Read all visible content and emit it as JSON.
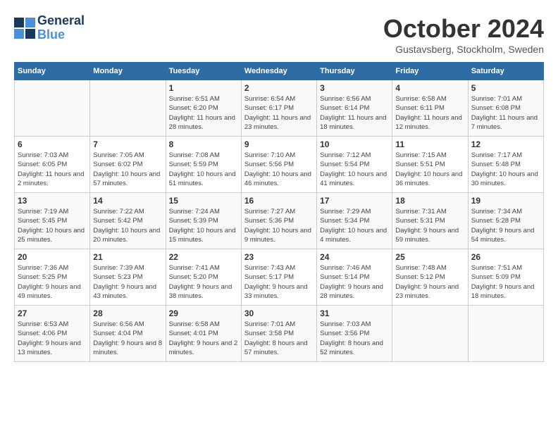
{
  "header": {
    "logo_line1": "General",
    "logo_line2": "Blue",
    "month": "October 2024",
    "location": "Gustavsberg, Stockholm, Sweden"
  },
  "days_of_week": [
    "Sunday",
    "Monday",
    "Tuesday",
    "Wednesday",
    "Thursday",
    "Friday",
    "Saturday"
  ],
  "weeks": [
    [
      {
        "day": "",
        "details": ""
      },
      {
        "day": "",
        "details": ""
      },
      {
        "day": "1",
        "details": "Sunrise: 6:51 AM\nSunset: 6:20 PM\nDaylight: 11 hours and 28 minutes."
      },
      {
        "day": "2",
        "details": "Sunrise: 6:54 AM\nSunset: 6:17 PM\nDaylight: 11 hours and 23 minutes."
      },
      {
        "day": "3",
        "details": "Sunrise: 6:56 AM\nSunset: 6:14 PM\nDaylight: 11 hours and 18 minutes."
      },
      {
        "day": "4",
        "details": "Sunrise: 6:58 AM\nSunset: 6:11 PM\nDaylight: 11 hours and 12 minutes."
      },
      {
        "day": "5",
        "details": "Sunrise: 7:01 AM\nSunset: 6:08 PM\nDaylight: 11 hours and 7 minutes."
      }
    ],
    [
      {
        "day": "6",
        "details": "Sunrise: 7:03 AM\nSunset: 6:05 PM\nDaylight: 11 hours and 2 minutes."
      },
      {
        "day": "7",
        "details": "Sunrise: 7:05 AM\nSunset: 6:02 PM\nDaylight: 10 hours and 57 minutes."
      },
      {
        "day": "8",
        "details": "Sunrise: 7:08 AM\nSunset: 5:59 PM\nDaylight: 10 hours and 51 minutes."
      },
      {
        "day": "9",
        "details": "Sunrise: 7:10 AM\nSunset: 5:56 PM\nDaylight: 10 hours and 46 minutes."
      },
      {
        "day": "10",
        "details": "Sunrise: 7:12 AM\nSunset: 5:54 PM\nDaylight: 10 hours and 41 minutes."
      },
      {
        "day": "11",
        "details": "Sunrise: 7:15 AM\nSunset: 5:51 PM\nDaylight: 10 hours and 36 minutes."
      },
      {
        "day": "12",
        "details": "Sunrise: 7:17 AM\nSunset: 5:48 PM\nDaylight: 10 hours and 30 minutes."
      }
    ],
    [
      {
        "day": "13",
        "details": "Sunrise: 7:19 AM\nSunset: 5:45 PM\nDaylight: 10 hours and 25 minutes."
      },
      {
        "day": "14",
        "details": "Sunrise: 7:22 AM\nSunset: 5:42 PM\nDaylight: 10 hours and 20 minutes."
      },
      {
        "day": "15",
        "details": "Sunrise: 7:24 AM\nSunset: 5:39 PM\nDaylight: 10 hours and 15 minutes."
      },
      {
        "day": "16",
        "details": "Sunrise: 7:27 AM\nSunset: 5:36 PM\nDaylight: 10 hours and 9 minutes."
      },
      {
        "day": "17",
        "details": "Sunrise: 7:29 AM\nSunset: 5:34 PM\nDaylight: 10 hours and 4 minutes."
      },
      {
        "day": "18",
        "details": "Sunrise: 7:31 AM\nSunset: 5:31 PM\nDaylight: 9 hours and 59 minutes."
      },
      {
        "day": "19",
        "details": "Sunrise: 7:34 AM\nSunset: 5:28 PM\nDaylight: 9 hours and 54 minutes."
      }
    ],
    [
      {
        "day": "20",
        "details": "Sunrise: 7:36 AM\nSunset: 5:25 PM\nDaylight: 9 hours and 49 minutes."
      },
      {
        "day": "21",
        "details": "Sunrise: 7:39 AM\nSunset: 5:23 PM\nDaylight: 9 hours and 43 minutes."
      },
      {
        "day": "22",
        "details": "Sunrise: 7:41 AM\nSunset: 5:20 PM\nDaylight: 9 hours and 38 minutes."
      },
      {
        "day": "23",
        "details": "Sunrise: 7:43 AM\nSunset: 5:17 PM\nDaylight: 9 hours and 33 minutes."
      },
      {
        "day": "24",
        "details": "Sunrise: 7:46 AM\nSunset: 5:14 PM\nDaylight: 9 hours and 28 minutes."
      },
      {
        "day": "25",
        "details": "Sunrise: 7:48 AM\nSunset: 5:12 PM\nDaylight: 9 hours and 23 minutes."
      },
      {
        "day": "26",
        "details": "Sunrise: 7:51 AM\nSunset: 5:09 PM\nDaylight: 9 hours and 18 minutes."
      }
    ],
    [
      {
        "day": "27",
        "details": "Sunrise: 6:53 AM\nSunset: 4:06 PM\nDaylight: 9 hours and 13 minutes."
      },
      {
        "day": "28",
        "details": "Sunrise: 6:56 AM\nSunset: 4:04 PM\nDaylight: 9 hours and 8 minutes."
      },
      {
        "day": "29",
        "details": "Sunrise: 6:58 AM\nSunset: 4:01 PM\nDaylight: 9 hours and 2 minutes."
      },
      {
        "day": "30",
        "details": "Sunrise: 7:01 AM\nSunset: 3:58 PM\nDaylight: 8 hours and 57 minutes."
      },
      {
        "day": "31",
        "details": "Sunrise: 7:03 AM\nSunset: 3:56 PM\nDaylight: 8 hours and 52 minutes."
      },
      {
        "day": "",
        "details": ""
      },
      {
        "day": "",
        "details": ""
      }
    ]
  ]
}
